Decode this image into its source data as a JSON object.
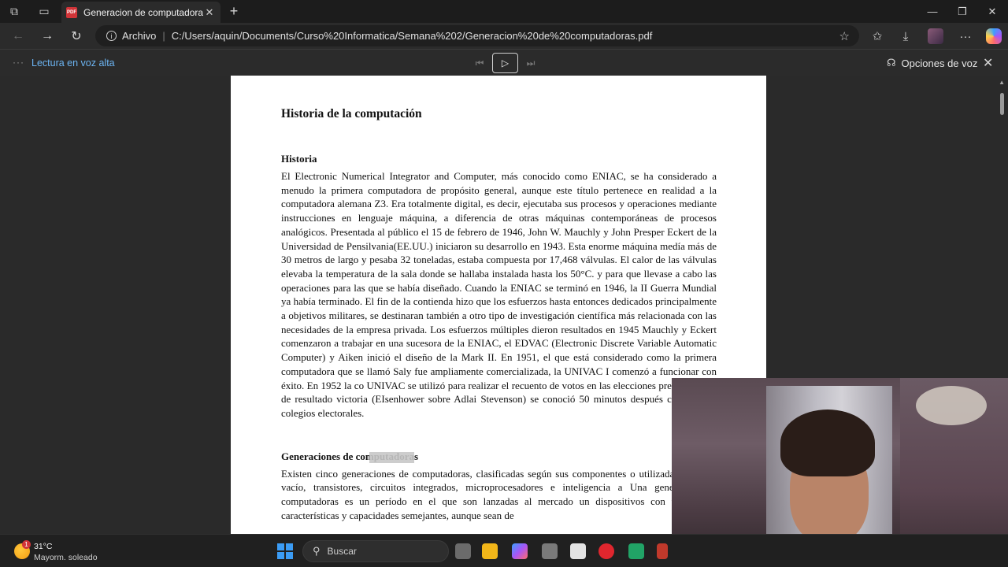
{
  "browser": {
    "tab_title": "Generacion de computadoras.pdf",
    "tab_badge": "PDF",
    "address_label": "Archivo",
    "address_url": "C:/Users/aquin/Documents/Curso%20Informatica/Semana%202/Generacion%20de%20computadoras.pdf"
  },
  "read_aloud": {
    "label": "Lectura en voz alta",
    "voice_options": "Opciones de voz"
  },
  "document": {
    "title": "Historia de la computación",
    "section1_heading": "Historia",
    "section1_text": "El Electronic Numerical Integrator and Computer, más conocido como ENIAC, se ha considerado a menudo la primera computadora de propósito general, aunque este título pertenece en realidad a la computadora alemana Z3. Era totalmente digital, es decir, ejecutaba sus procesos y operaciones mediante instrucciones en lenguaje máquina, a diferencia de otras máquinas contemporáneas de procesos analógicos. Presentada al público el 15 de febrero de 1946, John W. Mauchly y John Presper Eckert de la Universidad de Pensilvania(EE.UU.) iniciaron su desarrollo en 1943. Esta enorme máquina medía más de 30 metros de largo y pesaba 32 toneladas, estaba compuesta por 17,468 válvulas. El calor de las válvulas elevaba la temperatura de la sala donde se hallaba instalada hasta los 50°C. y para que llevase a cabo las operaciones para las que se había diseñado. Cuando la ENIAC se terminó en 1946, la II Guerra Mundial ya había terminado. El fin de la contienda hizo que los esfuerzos hasta entonces dedicados principalmente a objetivos militares, se destinaran también a otro tipo de investigación científica más relacionada con las necesidades de la empresa privada. Los esfuerzos múltiples dieron resultados en 1945 Mauchly y Eckert comenzaron a trabajar en una sucesora de la ENIAC, el EDVAC (Electronic Discrete Variable Automatic Computer) y Aiken inició el diseño de la Mark II. En 1951, el que está considerado como la primera computadora que se llamó Saly fue ampliamente comercializada, la UNIVAC I comenzó a funcionar con éxito. En 1952 la co UNIVAC se utilizó para realizar el recuento de votos en las elecciones presidenciales de resultado victoria (EIsenhower sobre Adlai Stevenson) se conoció 50 minutos después cerraran los colegios electorales.",
    "section2_heading": "Generaciones de computadoras",
    "section2_text": "Existen cinco generaciones de computadoras, clasificadas según sus componentes o utilizada: tubos de vacío, transistores, circuitos integrados, microprocesadores e inteligencia a Una generación de computadoras es un período en el que son lanzadas al mercado un dispositivos con tecnología, características y capacidades semejantes, aunque sean de"
  },
  "taskbar": {
    "weather_temp": "31°C",
    "weather_desc": "Mayorm. soleado",
    "weather_badge": "1",
    "search_label": "Buscar"
  },
  "colors": {
    "accent": "#6cb4f2",
    "pdf_badge": "#d13438"
  }
}
